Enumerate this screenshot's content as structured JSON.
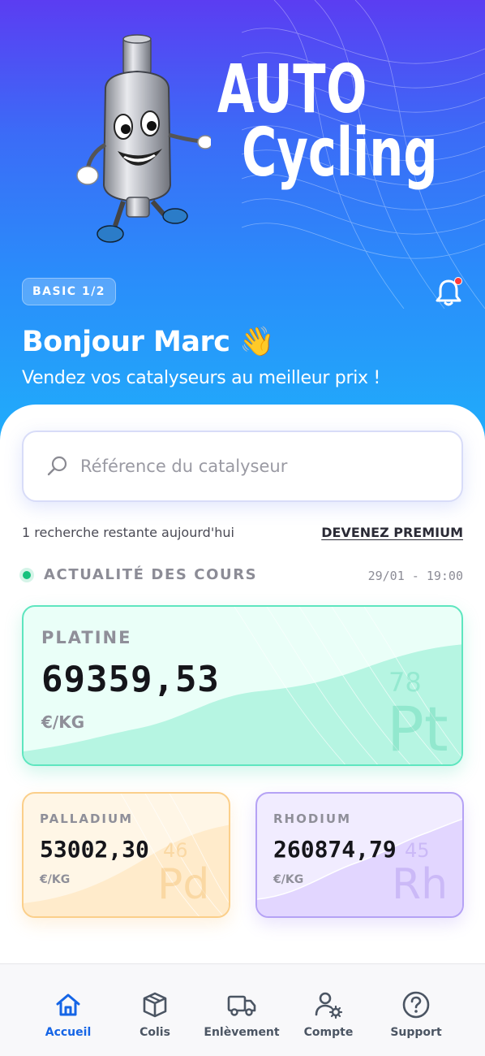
{
  "brand": {
    "line1": "AUTO",
    "line2": "Cycling"
  },
  "header": {
    "plan_badge": "BASIC 1/2",
    "greeting": "Bonjour Marc 👋",
    "tagline": "Vendez vos catalyseurs au meilleur prix !"
  },
  "search": {
    "placeholder": "Référence du catalyseur"
  },
  "limits": {
    "remaining_text": "1 recherche restante aujourd'hui",
    "premium_link": "DEVENEZ PREMIUM"
  },
  "prices_section": {
    "title": "ACTUALITÉ DES COURS",
    "timestamp": "29/01 - 19:00"
  },
  "metals": [
    {
      "name": "PLATINE",
      "price": "69359,53",
      "unit": "€/KG",
      "atomic_number": "78",
      "symbol": "Pt",
      "color": "#5ee6bf"
    },
    {
      "name": "PALLADIUM",
      "price": "53002,30",
      "unit": "€/KG",
      "atomic_number": "46",
      "symbol": "Pd",
      "color": "#fbcf8a"
    },
    {
      "name": "RHODIUM",
      "price": "260874,79",
      "unit": "€/KG",
      "atomic_number": "45",
      "symbol": "Rh",
      "color": "#b5a2f5"
    }
  ],
  "nav": {
    "active": "Accueil",
    "items": [
      {
        "label": "Accueil",
        "icon": "home-icon"
      },
      {
        "label": "Colis",
        "icon": "package-icon"
      },
      {
        "label": "Enlèvement",
        "icon": "truck-icon"
      },
      {
        "label": "Compte",
        "icon": "user-settings-icon"
      },
      {
        "label": "Support",
        "icon": "help-icon"
      }
    ]
  },
  "colors": {
    "accent": "#1565e6",
    "hero_top": "#5b3df2",
    "hero_bottom": "#1fb0fb",
    "live": "#17c17d",
    "alert": "#ff3b3b"
  }
}
